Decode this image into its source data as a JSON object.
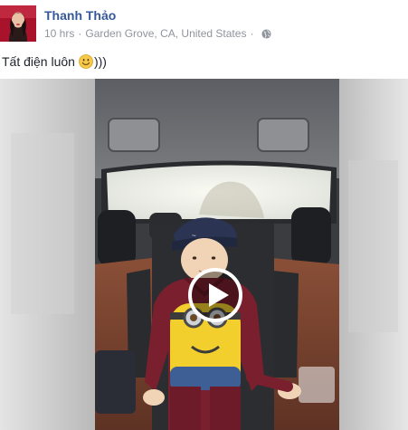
{
  "post": {
    "author": "Thanh Thảo",
    "time": "10 hrs",
    "separator": "·",
    "location": "Garden Grove, CA, United States",
    "meta_separator": "·",
    "message_before_emoji": "Tất điện luôn",
    "message_after_emoji": ")))",
    "audience_icon": "globe-icon",
    "emoji_icon": "smiley-icon"
  },
  "video": {
    "play_icon": "play-icon"
  },
  "colors": {
    "author_link": "#365899",
    "meta_text": "#90949c",
    "body_text": "#1d2129",
    "emoji_yellow": "#f7c948"
  }
}
